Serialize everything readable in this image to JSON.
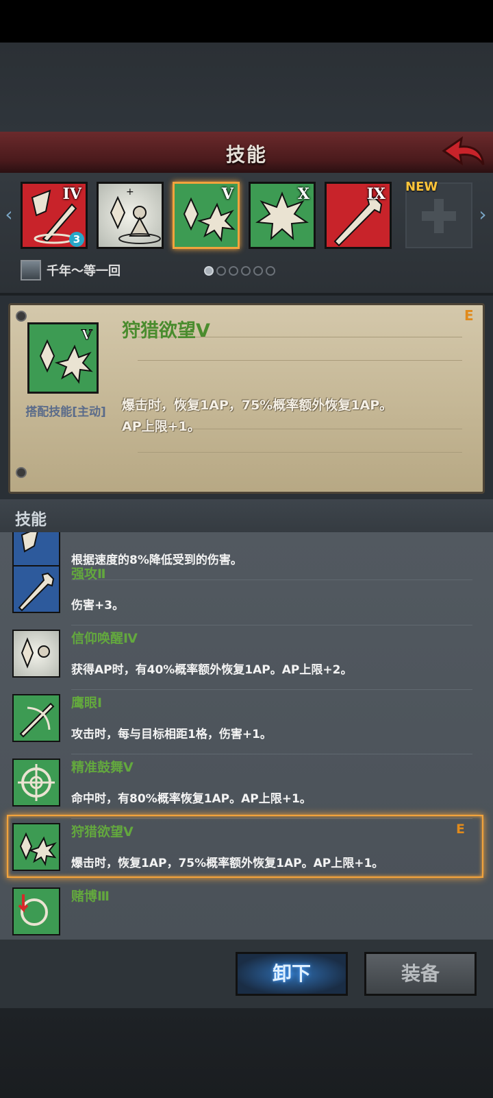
{
  "header": {
    "title": "技能"
  },
  "strip": {
    "slots": [
      {
        "roman": "IV",
        "level": "3",
        "bg": "#c8232a"
      },
      {
        "roman": "",
        "bg": "#d7d7cf"
      },
      {
        "roman": "V",
        "bg": "#3d9b53",
        "selected": true
      },
      {
        "roman": "X",
        "bg": "#3d9b53"
      },
      {
        "roman": "IX",
        "bg": "#c8232a"
      }
    ],
    "new_label": "NEW",
    "player_name": "千年～等一回",
    "page_dots": 6,
    "active_dot": 0
  },
  "card": {
    "name": "狩猎欲望Ⅴ",
    "grade": "E",
    "type": "搭配技能[主动]",
    "desc_line1": "爆击时，恢复1AP，75%概率额外恢复1AP。",
    "desc_line2": "AP上限+1。"
  },
  "list": {
    "title": "技能",
    "items": [
      {
        "name": "",
        "desc": "根据速度的8%降低受到的伤害。",
        "color": "#2d5a9c"
      },
      {
        "name": "强攻Ⅱ",
        "desc": "伤害+3。",
        "color": "#2d5a9c"
      },
      {
        "name": "信仰唤醒Ⅳ",
        "desc": "获得AP时，有40%概率额外恢复1AP。AP上限+2。",
        "color": "#d7d7cf"
      },
      {
        "name": "鹰眼Ⅰ",
        "desc": "攻击时，每与目标相距1格，伤害+1。",
        "color": "#3d9b53"
      },
      {
        "name": "精准鼓舞Ⅴ",
        "desc": "命中时，有80%概率恢复1AP。AP上限+1。",
        "color": "#3d9b53"
      },
      {
        "name": "狩猎欲望Ⅴ",
        "desc": "爆击时，恢复1AP，75%概率额外恢复1AP。AP上限+1。",
        "color": "#3d9b53",
        "grade": "E",
        "selected": true
      },
      {
        "name": "赌博Ⅲ",
        "desc": "",
        "color": "#3d9b53"
      }
    ]
  },
  "buttons": {
    "unequip": "卸下",
    "equip": "装备"
  }
}
